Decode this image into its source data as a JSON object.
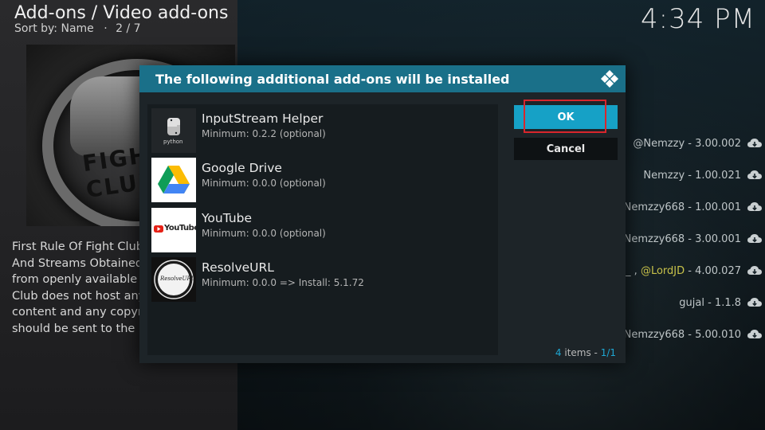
{
  "header": {
    "breadcrumb": "Add-ons / Video add-ons",
    "sort_label": "Sort by: Name",
    "separator": "·",
    "position": "2 / 7",
    "clock": "4:34 PM"
  },
  "fanart": {
    "text": "FIGHT CLUB"
  },
  "description_lines": [
    "First Rule Of Fight Club..",
    "And Streams Obtained u",
    "from openly available so",
    "Club does not host any c",
    "content and any copyrig",
    "should be sent to the ho"
  ],
  "background_list": [
    {
      "text": "@Nemzzy - 3.00.002"
    },
    {
      "text": "Nemzzy - 1.00.021"
    },
    {
      "text": "Nemzzy668 - 1.00.001"
    },
    {
      "text": "Nemzzy668 - 3.00.001"
    },
    {
      "text_a": "c_ , ",
      "text_b": "@LordJD",
      "text_c": " - 4.00.027"
    },
    {
      "text": "gujal - 1.1.8"
    },
    {
      "text": "Nemzzy668 - 5.00.010"
    }
  ],
  "dialog": {
    "title": "The following additional add-ons will be installed",
    "ok_label": "OK",
    "cancel_label": "Cancel",
    "count_num": "4",
    "count_word": " items - ",
    "count_page": "1/1",
    "items": [
      {
        "title": "InputStream Helper",
        "subtitle": "Minimum: 0.2.2 (optional)",
        "icon": "python-icon",
        "icon_text": "python"
      },
      {
        "title": "Google Drive",
        "subtitle": "Minimum: 0.0.0 (optional)",
        "icon": "google-drive-icon"
      },
      {
        "title": "YouTube",
        "subtitle": "Minimum: 0.0.0 (optional)",
        "icon": "youtube-icon",
        "icon_text": "YouTube"
      },
      {
        "title": "ResolveURL",
        "subtitle": "Minimum: 0.0.0 => Install: 5.1.72",
        "icon": "resolveurl-icon",
        "icon_text": "ResolveURL"
      }
    ]
  },
  "colors": {
    "header_bar": "#1a7089",
    "ok_button": "#16a1c6",
    "highlight_box": "#d8262c",
    "count_accent": "#1ea7d4"
  }
}
